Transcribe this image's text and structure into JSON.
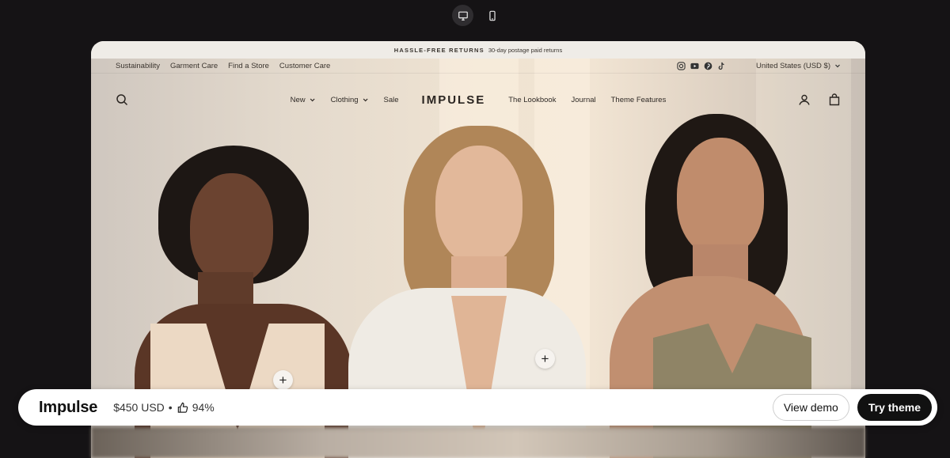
{
  "device_toggle": {
    "options": [
      "desktop-icon",
      "mobile-icon"
    ],
    "selected": "desktop"
  },
  "store": {
    "announcement": {
      "strong": "HASSLE-FREE RETURNS",
      "text": "30-day postage paid returns"
    },
    "utility_links": [
      "Sustainability",
      "Garment Care",
      "Find a Store",
      "Customer Care"
    ],
    "social_icons": [
      "instagram-icon",
      "youtube-icon",
      "pinterest-icon",
      "tiktok-icon"
    ],
    "locale": "United States (USD $)",
    "nav": {
      "left": [
        {
          "label": "New",
          "dropdown": true
        },
        {
          "label": "Clothing",
          "dropdown": true
        },
        {
          "label": "Sale",
          "dropdown": false
        }
      ],
      "logo": "IMPULSE",
      "right": [
        {
          "label": "The Lookbook"
        },
        {
          "label": "Journal"
        },
        {
          "label": "Theme Features"
        }
      ]
    }
  },
  "theme_bar": {
    "name": "Impulse",
    "price": "$450 USD",
    "separator": "•",
    "rating": "94%",
    "view_demo": "View demo",
    "try_theme": "Try theme"
  },
  "colors": {
    "page_bg": "#151315",
    "accent": "#111111"
  }
}
